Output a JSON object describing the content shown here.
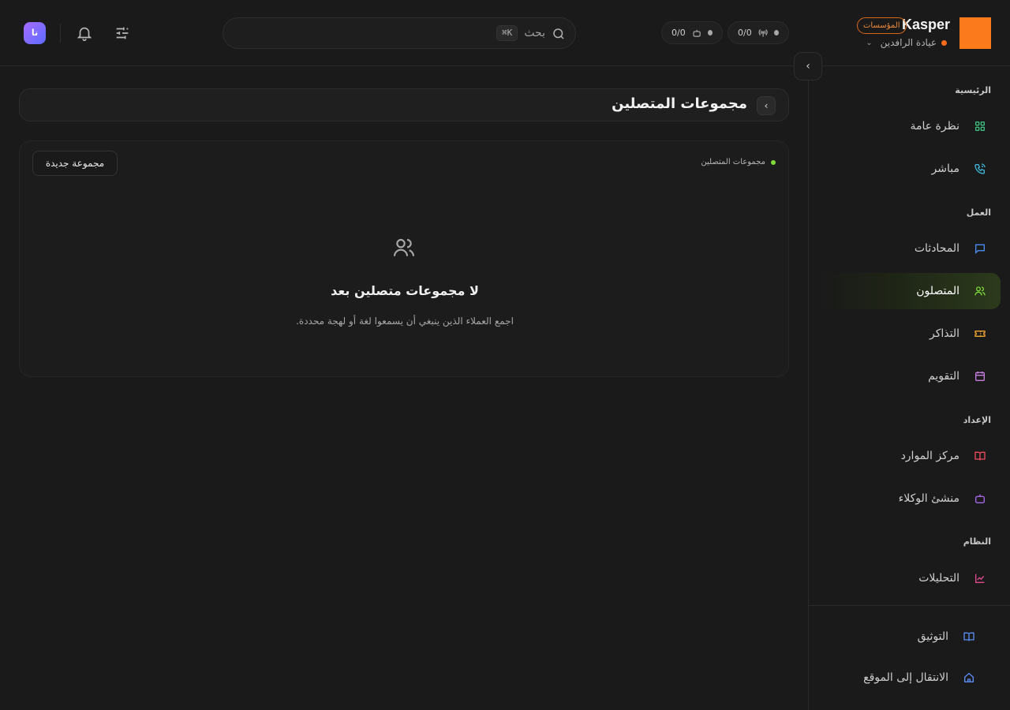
{
  "brand": {
    "name": "Kasper",
    "badge": "المؤسسات",
    "org": "عيادة الرافدين",
    "logo_color": "#fb7a1c"
  },
  "header": {
    "stat_broadcast": "0/0",
    "stat_bot": "0/0",
    "search_label": "بحث",
    "search_shortcut": "⌘K",
    "avatar_initials": "نا"
  },
  "sidebar": {
    "sections": [
      {
        "title": "الرئيسية"
      },
      {
        "title": "العمل"
      },
      {
        "title": "الإعداد"
      },
      {
        "title": "النظام"
      }
    ],
    "items": [
      {
        "label": "نظرة عامة",
        "icon": "grid-icon",
        "color": "#3fbf7f"
      },
      {
        "label": "مباشر",
        "icon": "phone-icon",
        "color": "#3fb6d8"
      },
      {
        "label": "المحادثات",
        "icon": "chat-icon",
        "color": "#4a8df2"
      },
      {
        "label": "المتصلون",
        "icon": "users-icon",
        "color": "#7ddc3a"
      },
      {
        "label": "التذاكر",
        "icon": "ticket-icon",
        "color": "#f0a030"
      },
      {
        "label": "التقويم",
        "icon": "calendar-icon",
        "color": "#c77de0"
      },
      {
        "label": "مركز الموارد",
        "icon": "book-icon",
        "color": "#ef4b5a"
      },
      {
        "label": "منشئ الوكلاء",
        "icon": "bot-icon",
        "color": "#a768f0"
      },
      {
        "label": "التحليلات",
        "icon": "chart-icon",
        "color": "#e04a8a"
      }
    ],
    "footer": [
      {
        "label": "التوثيق",
        "icon": "book-open-icon",
        "color": "#5a8cf2"
      },
      {
        "label": "الانتقال إلى الموقع",
        "icon": "home-icon",
        "color": "#5a8cf2"
      }
    ]
  },
  "main": {
    "page_title": "مجموعات المتصلين",
    "panel_label": "مجموعات المتصلين",
    "new_group_button": "مجموعة جديدة",
    "empty_title": "لا مجموعات متصلين بعد",
    "empty_description": "اجمع العملاء الذين ينبغي أن يسمعوا لغة أو لهجة محددة."
  }
}
